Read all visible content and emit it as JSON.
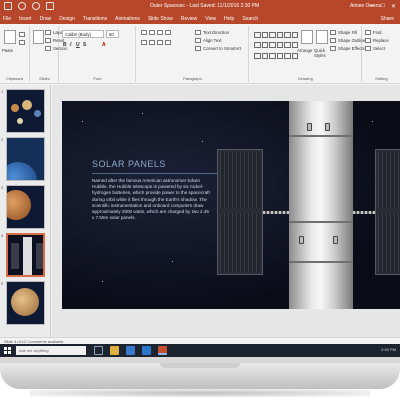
{
  "titlebar": {
    "title": "Outer Spacearc - Last Saved: 11/1/2016 2:30 PM",
    "user": "Aimee Owens",
    "controls": [
      "—",
      "□",
      "✕"
    ]
  },
  "tabs": [
    "File",
    "Insert",
    "Draw",
    "Design",
    "Transitions",
    "Animations",
    "Slide Show",
    "Review",
    "View",
    "Help",
    "Search"
  ],
  "active_tab": "File",
  "share_label": "Share",
  "ribbon": {
    "groups": {
      "clipboard": "Clipboard",
      "slides": "Slides",
      "font": "Font",
      "paragraph": "Paragraph",
      "drawing": "Drawing",
      "editing": "Editing"
    },
    "slides_items": [
      "Layout",
      "Reset",
      "Section"
    ],
    "new_slide": "New Slide",
    "paste": "Paste",
    "font_name": "Calibri (Body)",
    "font_size": "60",
    "paragraph_items": [
      "Text Direction",
      "Align Text",
      "Convert to SmartArt"
    ],
    "drawing_items": [
      "Shape Fill",
      "Shape Outline",
      "Shape Effects"
    ],
    "arrange": "Arrange",
    "quick_styles": "Quick Styles",
    "editing_items": [
      "Find",
      "Replace",
      "Select"
    ]
  },
  "slide": {
    "title": "SOLAR PANELS",
    "body": "Named after the famous American astronomer Edwin Hubble, the Hubble telescope is powered by six nickel-hydrogen batteries, which provide power to the spacecraft during orbit while it flies through the Earth's shadow. The scientific instrumentation and onboard computers draw approximately 2800 watts, which are charged by two 2.45 x 7.56m solar panels."
  },
  "thumbnails": [
    {
      "num": "1"
    },
    {
      "num": "2"
    },
    {
      "num": "3"
    },
    {
      "num": "4"
    },
    {
      "num": "5"
    }
  ],
  "statusbar": {
    "text": "Slide 4 of 12   Comments available"
  },
  "taskbar": {
    "search_placeholder": "Ask me anything",
    "tray": "2:30 PM"
  },
  "colors": {
    "accent": "#b7472a",
    "taskbar": "#1c2430"
  }
}
